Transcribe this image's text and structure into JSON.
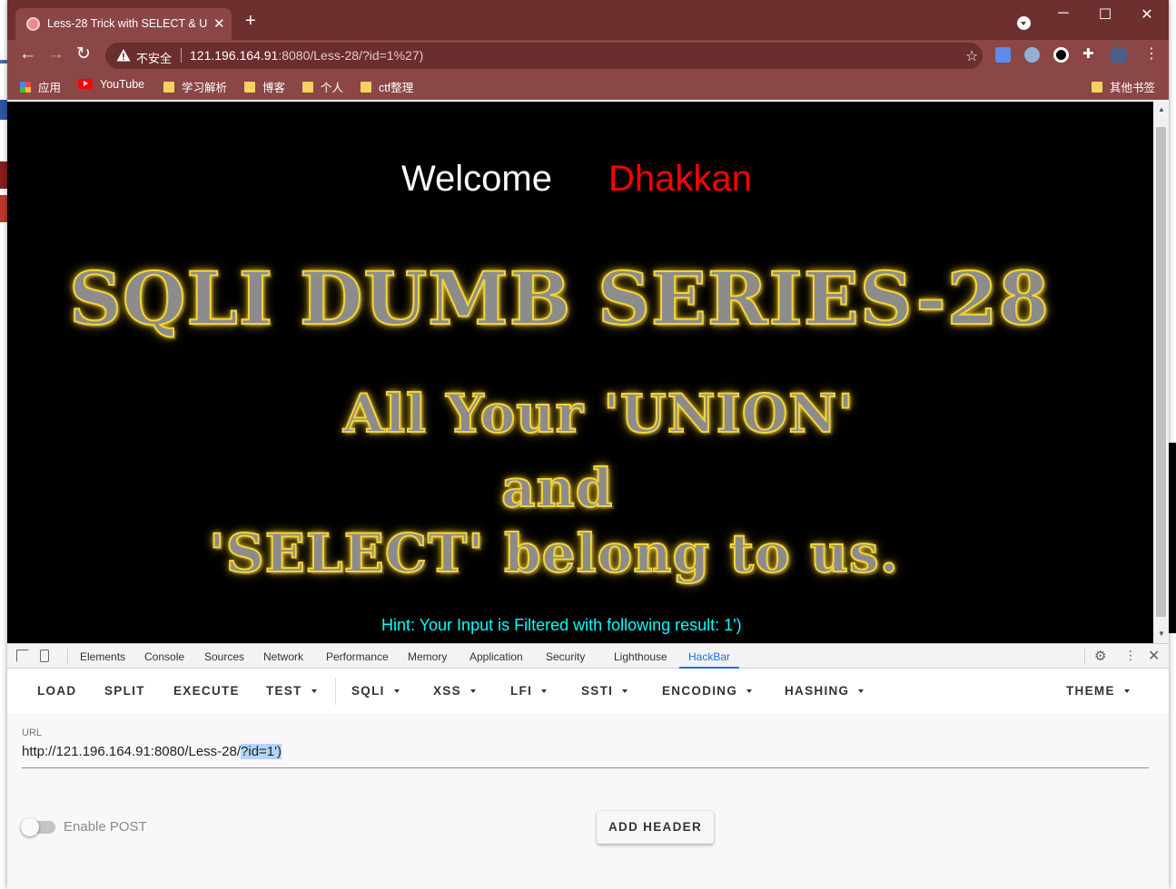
{
  "browser": {
    "tab_title": "Less-28 Trick with SELECT & U",
    "tab_close": "✕",
    "new_tab": "+",
    "window_controls": {
      "minimize": "─",
      "maximize": "☐",
      "close": "✕"
    },
    "address_bar": {
      "security_label": "不安全",
      "url_host": "121.196.164.91",
      "url_rest": ":8080/Less-28/?id=1%27)"
    },
    "bookmarks": [
      {
        "label": "应用",
        "icon": "apps-icon"
      },
      {
        "label": "YouTube",
        "icon": "youtube-icon"
      },
      {
        "label": "学习解析",
        "icon": "folder-icon"
      },
      {
        "label": "博客",
        "icon": "folder-icon"
      },
      {
        "label": "个人",
        "icon": "folder-icon"
      },
      {
        "label": "ctf整理",
        "icon": "folder-icon"
      },
      {
        "label": "其他书签",
        "icon": "folder-icon"
      }
    ]
  },
  "page": {
    "welcome": "Welcome",
    "user_name": "Dhakkan",
    "banner_title": "SQLI DUMB SERIES-28",
    "banner_line1": "All Your 'UNION'",
    "banner_line2": "and",
    "banner_line3": "'SELECT' belong to us.",
    "hint": "Hint: Your Input is Filtered with following result: 1')"
  },
  "devtools": {
    "tabs": [
      "Elements",
      "Console",
      "Sources",
      "Network",
      "Performance",
      "Memory",
      "Application",
      "Security",
      "Lighthouse",
      "HackBar"
    ],
    "active_tab": "HackBar"
  },
  "hackbar": {
    "buttons": {
      "load": "LOAD",
      "split": "SPLIT",
      "execute": "EXECUTE",
      "test": "TEST",
      "sqli": "SQLI",
      "xss": "XSS",
      "lfi": "LFI",
      "ssti": "SSTI",
      "encoding": "ENCODING",
      "hashing": "HASHING",
      "theme": "THEME"
    },
    "url_label": "URL",
    "url_prefix": "http://121.196.164.91:8080/Less-28/",
    "url_selected": "?id=1')",
    "enable_post": "Enable POST",
    "add_header": "ADD HEADER"
  },
  "colors": {
    "titlebar": "#6e2f2f",
    "toolbar": "#8b4646",
    "welcome_name": "#ff0000",
    "hint": "#00ffff",
    "active_tab": "#1a73e8"
  }
}
